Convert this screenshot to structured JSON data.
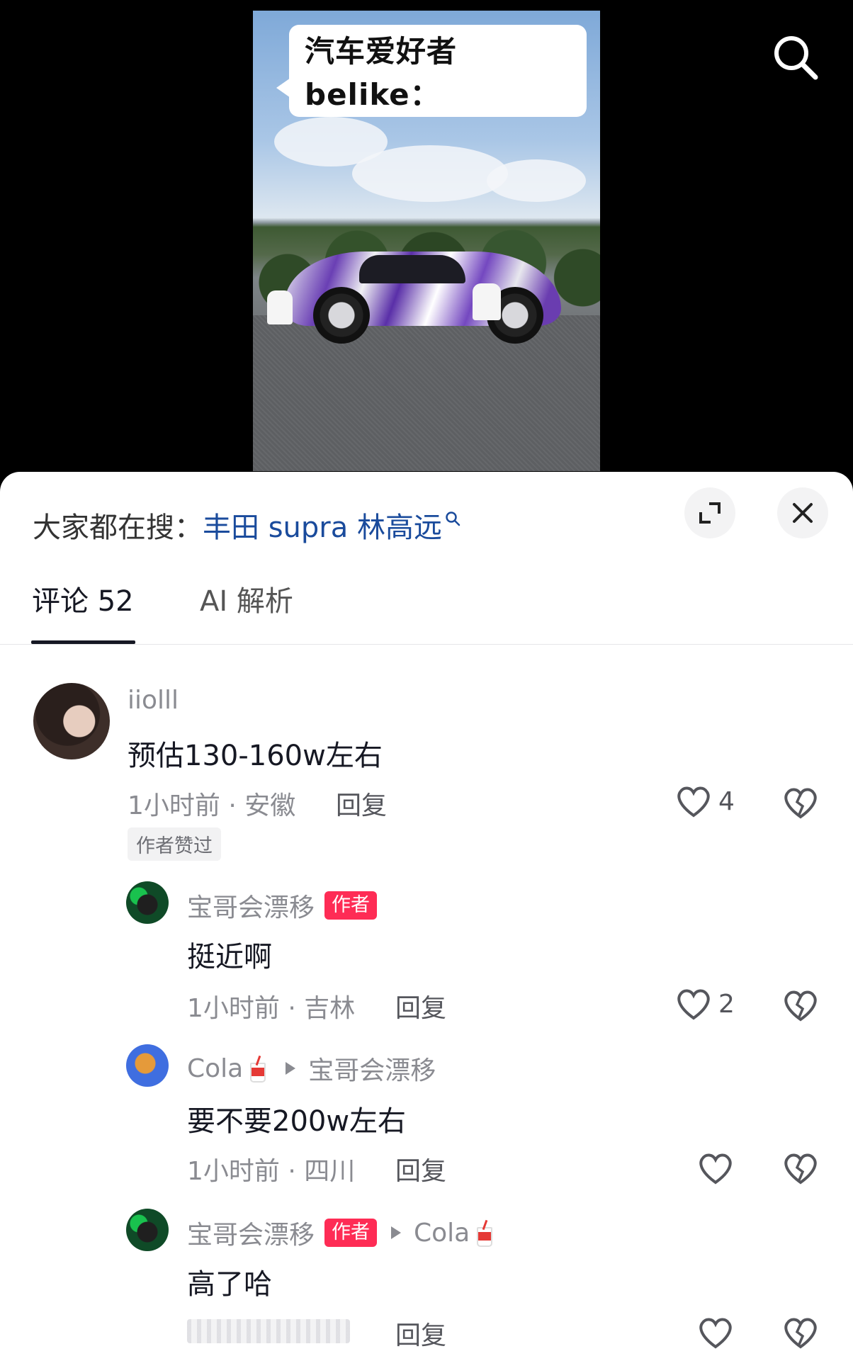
{
  "video": {
    "caption": "汽车爱好者belike："
  },
  "sheet": {
    "hot_search_prefix": "大家都在搜：",
    "hot_search_query": "丰田 supra 林高远"
  },
  "tabs": {
    "comments": "评论 52",
    "ai": "AI 解析"
  },
  "comments": [
    {
      "user": "iiolll",
      "text": "预估130-160w左右",
      "meta": "1小时前 · 安徽",
      "reply_label": "回复",
      "likes": "4",
      "liked_by_author": "作者赞过"
    },
    {
      "user": "宝哥会漂移",
      "badge": "作者",
      "text": "挺近啊",
      "meta": "1小时前 · 吉林",
      "reply_label": "回复",
      "likes": "2"
    },
    {
      "user": "Cola",
      "reply_to": "宝哥会漂移",
      "text": "要不要200w左右",
      "meta": "1小时前 · 四川",
      "reply_label": "回复"
    },
    {
      "user": "宝哥会漂移",
      "badge": "作者",
      "reply_to": "Cola",
      "text": "高了哈",
      "reply_label": "回复"
    }
  ],
  "colors": {
    "author_badge": "#fe2c55",
    "hot_query": "#1a4b9c",
    "meta_text": "#8a8b91"
  }
}
